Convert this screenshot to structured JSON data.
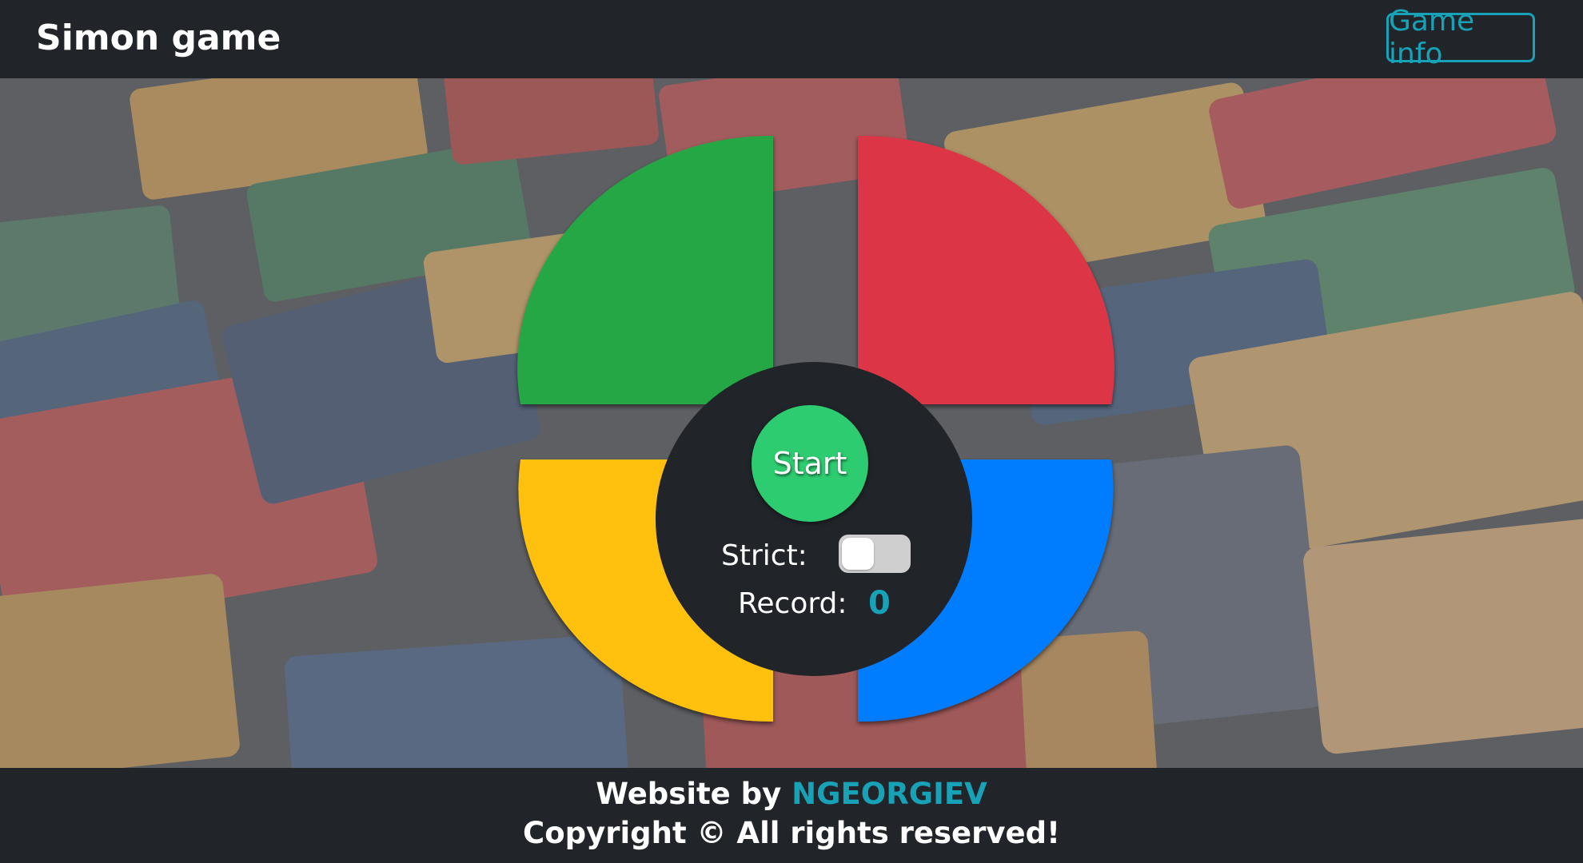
{
  "header": {
    "title": "Simon game",
    "info_button_label": "Game info"
  },
  "game": {
    "start_label": "Start",
    "strict_label": "Strict:",
    "strict_enabled": false,
    "record_label": "Record:",
    "record_value": "0",
    "pads": [
      {
        "position": "top-left",
        "color": "#28a745"
      },
      {
        "position": "top-right",
        "color": "#dc3545"
      },
      {
        "position": "bottom-left",
        "color": "#ffc107"
      },
      {
        "position": "bottom-right",
        "color": "#007bff"
      }
    ]
  },
  "footer": {
    "credit_prefix": "Website by",
    "author": "NGEORGIEV",
    "copyright": "Copyright © All rights reserved!"
  },
  "colors": {
    "dark": "#212529",
    "accent": "#17a2b8",
    "start_button": "#2ecc71"
  }
}
